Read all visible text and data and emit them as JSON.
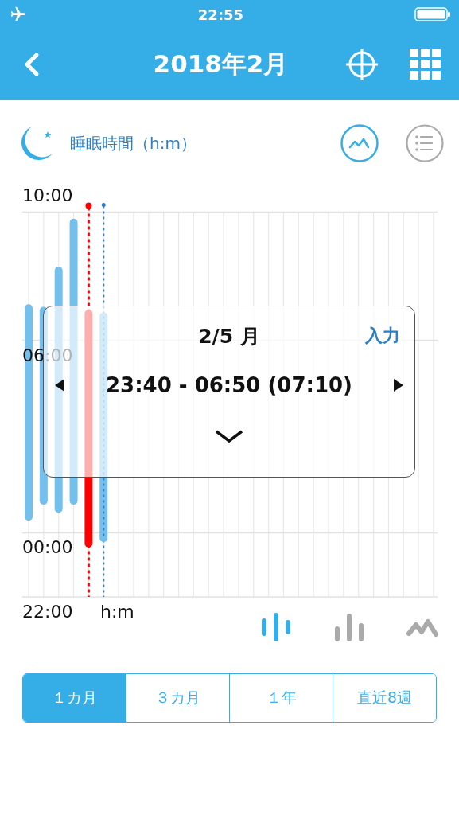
{
  "status_bar": {
    "time": "22:55"
  },
  "nav": {
    "title": "2018年2月"
  },
  "section": {
    "title": "睡眠時間（h:m）",
    "views": [
      {
        "kind": "chart",
        "selected": true
      },
      {
        "kind": "list",
        "selected": false
      }
    ]
  },
  "chart": {
    "axis_labels": [
      "10:00",
      "06:00",
      "00:00",
      "22:00"
    ],
    "unit": "h:m",
    "days": [
      {
        "kind": "past",
        "selected": false
      },
      {
        "kind": "past",
        "selected": false
      },
      {
        "kind": "past",
        "selected": false
      },
      {
        "kind": "past",
        "selected": false
      },
      {
        "kind": "past",
        "selected": true
      },
      {
        "kind": "today",
        "selected": false
      }
    ]
  },
  "popup": {
    "date": "2/5 月",
    "action": "入力",
    "range": "23:40 - 06:50 (07:10)"
  },
  "chart_types": [
    {
      "kind": "strip",
      "selected": true
    },
    {
      "kind": "bars",
      "selected": false
    },
    {
      "kind": "line",
      "selected": false
    }
  ],
  "periods": [
    {
      "label": "１カ月",
      "selected": true
    },
    {
      "label": "３カ月",
      "selected": false
    },
    {
      "label": "１年",
      "selected": false
    },
    {
      "label": "直近8週",
      "selected": false
    }
  ]
}
